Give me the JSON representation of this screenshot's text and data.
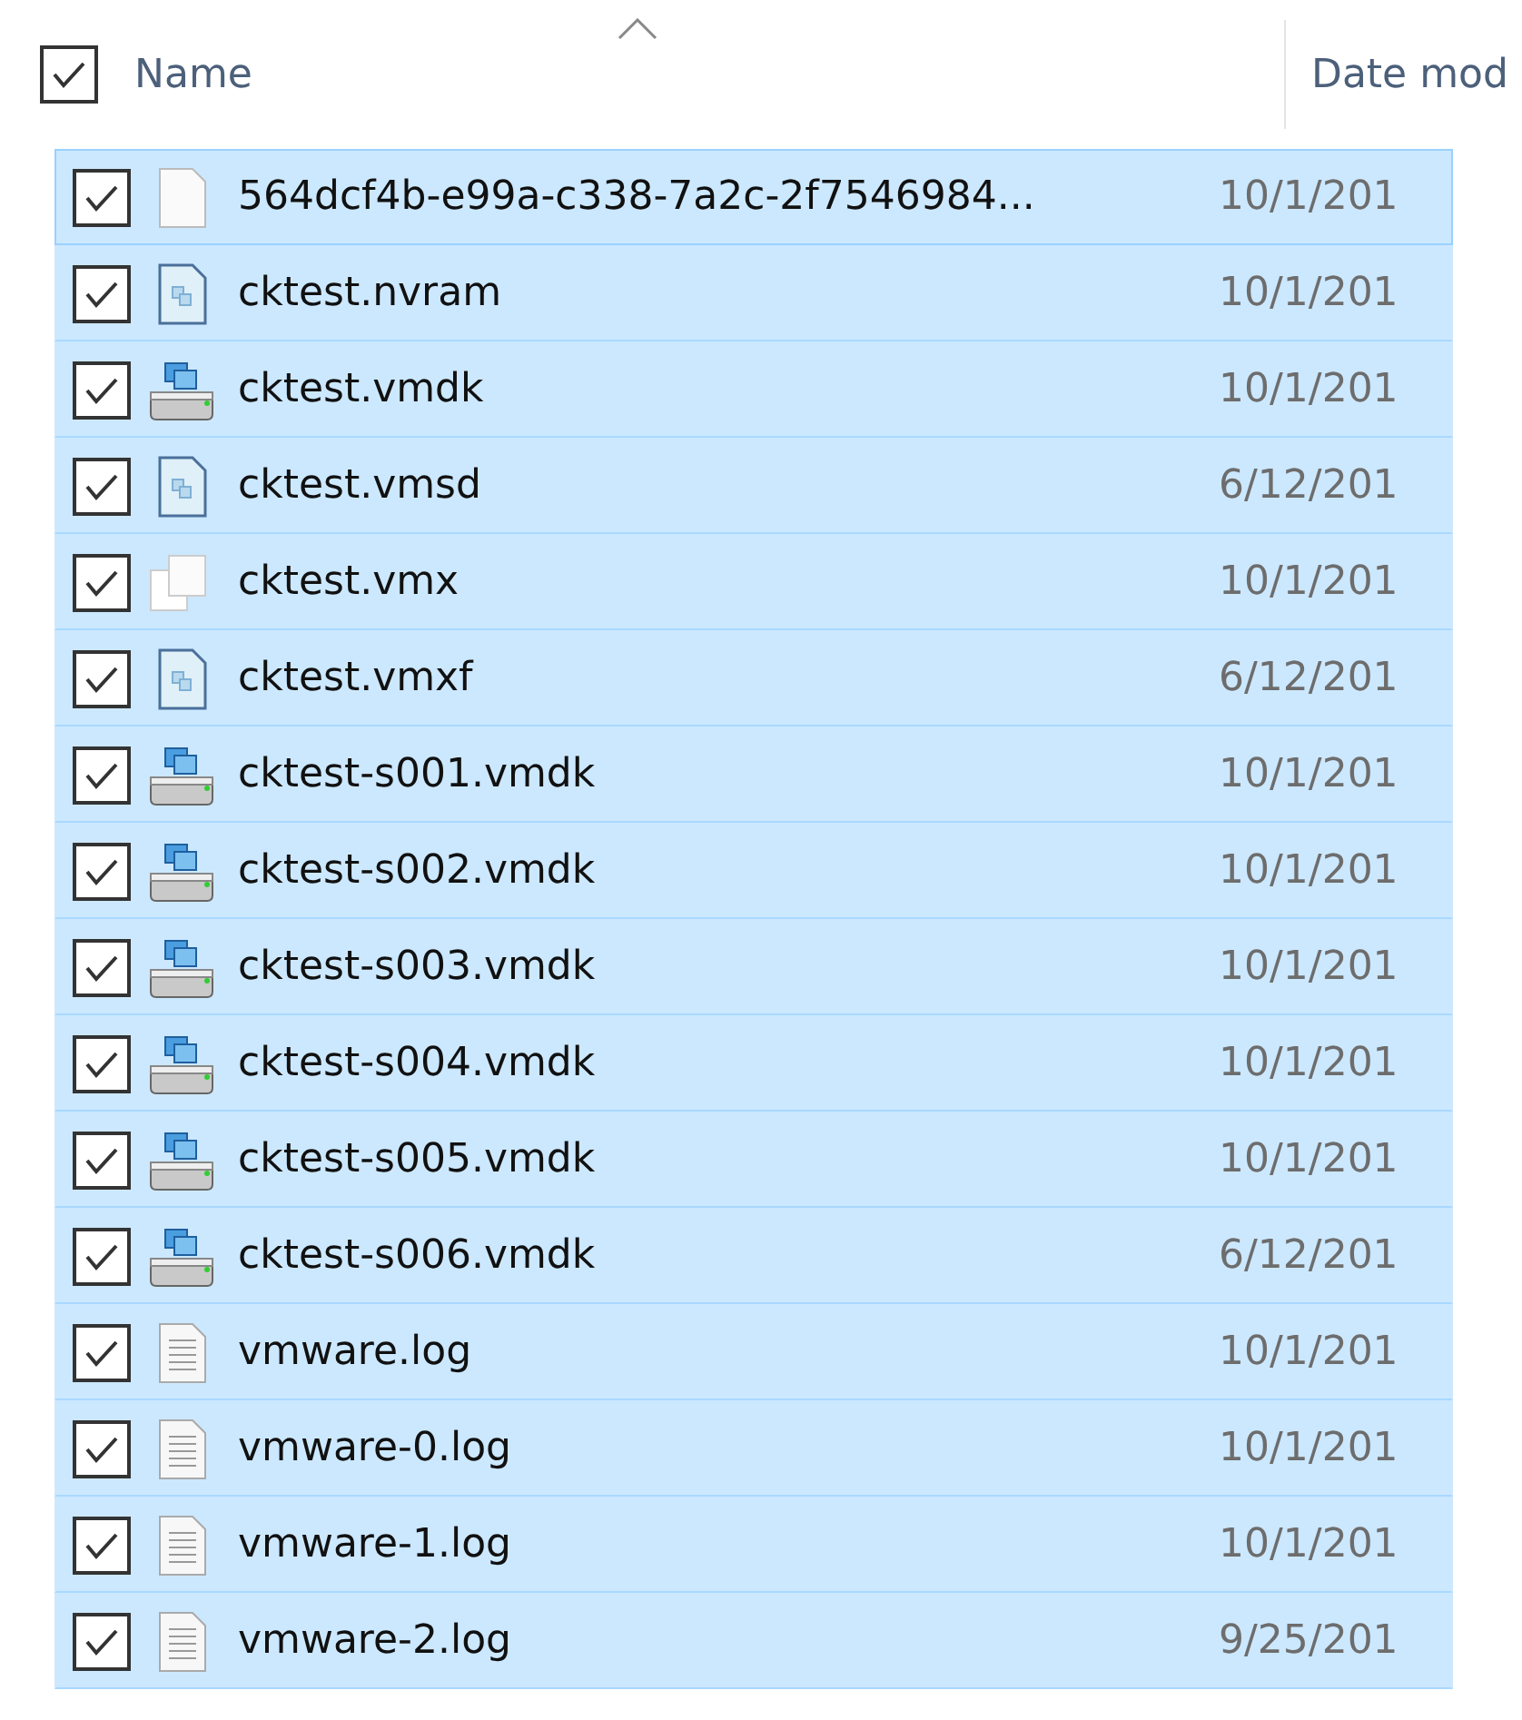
{
  "header": {
    "checked": true,
    "columns": [
      {
        "label": "Name",
        "sorted": true
      },
      {
        "label": "Date mod"
      }
    ]
  },
  "rows": [
    {
      "name": "564dcf4b-e99a-c338-7a2c-2f7546984...",
      "date": "10/1/201",
      "kind": "blank",
      "checked": true,
      "selected": true,
      "focused": true
    },
    {
      "name": "cktest.nvram",
      "date": "10/1/201",
      "kind": "config",
      "checked": true,
      "selected": true,
      "focused": false
    },
    {
      "name": "cktest.vmdk",
      "date": "10/1/201",
      "kind": "disk",
      "checked": true,
      "selected": true,
      "focused": false
    },
    {
      "name": "cktest.vmsd",
      "date": "6/12/201",
      "kind": "config",
      "checked": true,
      "selected": true,
      "focused": false
    },
    {
      "name": "cktest.vmx",
      "date": "10/1/201",
      "kind": "vmx",
      "checked": true,
      "selected": true,
      "focused": false
    },
    {
      "name": "cktest.vmxf",
      "date": "6/12/201",
      "kind": "config",
      "checked": true,
      "selected": true,
      "focused": false
    },
    {
      "name": "cktest-s001.vmdk",
      "date": "10/1/201",
      "kind": "disk",
      "checked": true,
      "selected": true,
      "focused": false
    },
    {
      "name": "cktest-s002.vmdk",
      "date": "10/1/201",
      "kind": "disk",
      "checked": true,
      "selected": true,
      "focused": false
    },
    {
      "name": "cktest-s003.vmdk",
      "date": "10/1/201",
      "kind": "disk",
      "checked": true,
      "selected": true,
      "focused": false
    },
    {
      "name": "cktest-s004.vmdk",
      "date": "10/1/201",
      "kind": "disk",
      "checked": true,
      "selected": true,
      "focused": false
    },
    {
      "name": "cktest-s005.vmdk",
      "date": "10/1/201",
      "kind": "disk",
      "checked": true,
      "selected": true,
      "focused": false
    },
    {
      "name": "cktest-s006.vmdk",
      "date": "6/12/201",
      "kind": "disk",
      "checked": true,
      "selected": true,
      "focused": false
    },
    {
      "name": "vmware.log",
      "date": "10/1/201",
      "kind": "log",
      "checked": true,
      "selected": true,
      "focused": false
    },
    {
      "name": "vmware-0.log",
      "date": "10/1/201",
      "kind": "log",
      "checked": true,
      "selected": true,
      "focused": false
    },
    {
      "name": "vmware-1.log",
      "date": "10/1/201",
      "kind": "log",
      "checked": true,
      "selected": true,
      "focused": false
    },
    {
      "name": "vmware-2.log",
      "date": "9/25/201",
      "kind": "log",
      "checked": true,
      "selected": true,
      "focused": false
    }
  ]
}
